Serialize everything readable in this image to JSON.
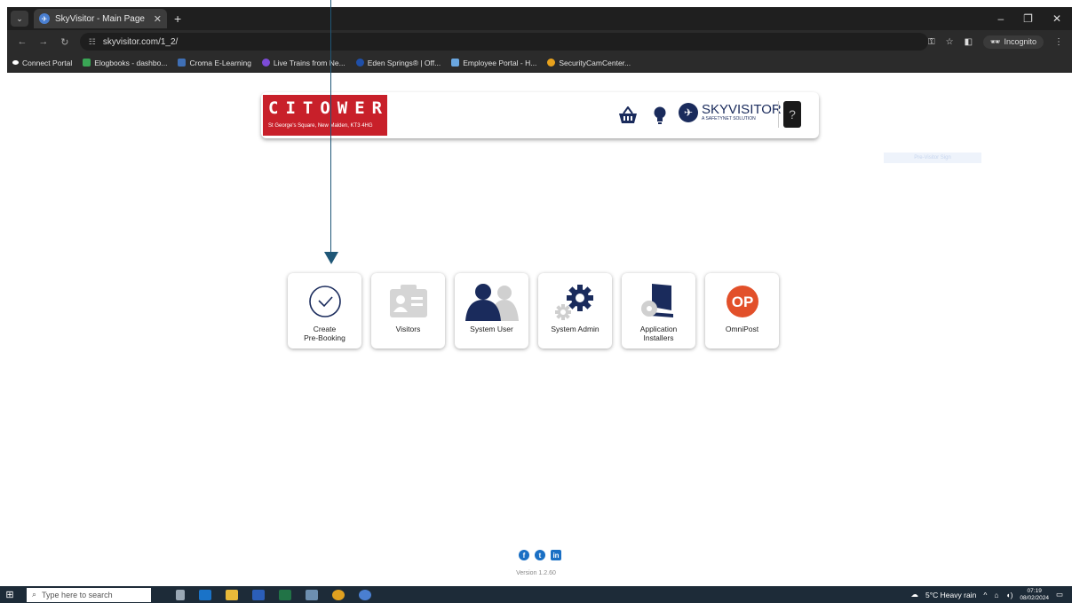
{
  "browser": {
    "tab_title": "SkyVisitor - Main Page",
    "url": "skyvisitor.com/1_2/",
    "incognito_label": "Incognito",
    "bookmarks": [
      {
        "label": "Connect Portal",
        "color": "#ffffff"
      },
      {
        "label": "Elogbooks - dashbo...",
        "color": "#3aa655"
      },
      {
        "label": "Croma E-Learning",
        "color": "#3f6fb5"
      },
      {
        "label": "Live Trains from Ne...",
        "color": "#7c4bd6"
      },
      {
        "label": "Eden Springs® | Off...",
        "color": "#1f4fa8"
      },
      {
        "label": "Employee Portal - H...",
        "color": "#6aa6e0"
      },
      {
        "label": "SecurityCamCenter...",
        "color": "#e8a21d"
      }
    ]
  },
  "header": {
    "brand_name": "CITOWER",
    "brand_address": "St George's Square, New Malden, KT3 4HG",
    "sky_title": "SKYVISITOR",
    "sky_sub": "A SAFETYNET SOLUTION",
    "basket_icon": "basket-icon",
    "idea_icon": "lightbulb-icon"
  },
  "ghost_text": "Pre-Visitor Sign",
  "tiles": [
    {
      "name": "create-pre-booking",
      "label": "Create\nPre-Booking",
      "icon": "clock-check-icon"
    },
    {
      "name": "visitors",
      "label": "Visitors",
      "icon": "id-card-icon"
    },
    {
      "name": "system-user",
      "label": "System User",
      "icon": "users-icon"
    },
    {
      "name": "system-admin",
      "label": "System Admin",
      "icon": "gears-icon"
    },
    {
      "name": "application-installers",
      "label": "Application\nInstallers",
      "icon": "installer-icon"
    },
    {
      "name": "omnipost",
      "label": "OmniPost",
      "icon": "op-logo"
    }
  ],
  "footer": {
    "version": "Version 1.2.60"
  },
  "taskbar": {
    "search_placeholder": "Type here to search",
    "weather": "5°C  Heavy rain",
    "time": "07:19",
    "date": "08/02/2024"
  },
  "colors": {
    "brand_red": "#c8202a",
    "navy": "#1a2b5c",
    "arrow": "#1f5777",
    "omnipost_orange": "#e2502a"
  }
}
